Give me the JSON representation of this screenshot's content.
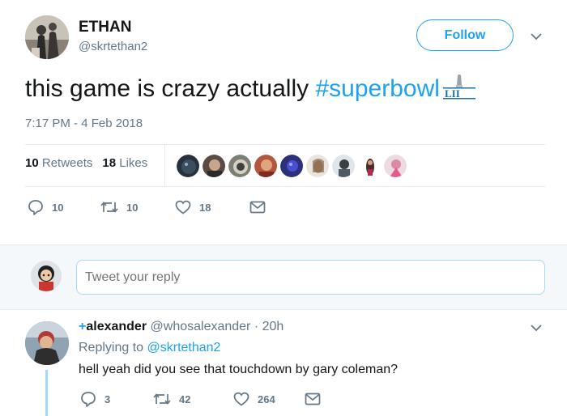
{
  "tweet": {
    "author_name": "ETHAN",
    "author_handle": "@skrtethan2",
    "follow_label": "Follow",
    "text_plain": "this game is crazy actually ",
    "hashtag": "#superbowl",
    "timestamp": "7:17 PM - 4 Feb 2018",
    "retweets_count": "10",
    "retweets_label": "Retweets",
    "likes_count": "18",
    "likes_label": "Likes",
    "actions": {
      "replies": "10",
      "retweets": "10",
      "likes": "18"
    }
  },
  "reply_box": {
    "placeholder": "Tweet your reply"
  },
  "reply": {
    "plus": "+",
    "author_name": "alexander",
    "author_handle": "@whosalexander",
    "separator": "·",
    "time": "20h",
    "replying_prefix": "Replying to",
    "replying_handle": "@skrtethan2",
    "text": "hell yeah did you see that touchdown by gary coleman?",
    "actions": {
      "replies": "3",
      "retweets": "42",
      "likes": "264"
    }
  },
  "colors": {
    "accent": "#1da1f2",
    "text": "#14171a",
    "secondary": "#657786",
    "border": "#e6ecf0",
    "reply_bg": "#f5f8fa"
  },
  "icons": [
    "chevron-down-icon",
    "reply-icon",
    "retweet-icon",
    "like-icon",
    "message-icon",
    "superbowl-logo"
  ]
}
